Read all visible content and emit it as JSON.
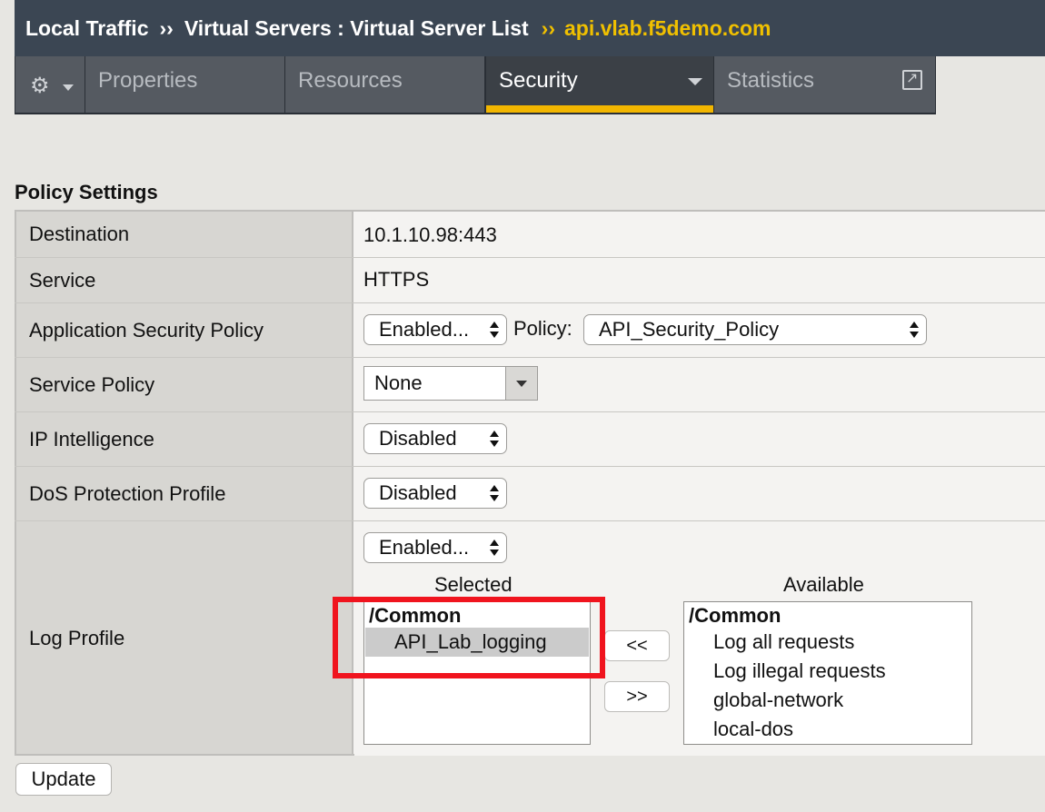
{
  "breadcrumb": {
    "part1": "Local Traffic",
    "sep": "››",
    "part2": "Virtual Servers : Virtual Server List",
    "current": "api.vlab.f5demo.com"
  },
  "tabs": {
    "menu_icon": "gear-icon",
    "items": [
      {
        "label": "Properties"
      },
      {
        "label": "Resources"
      },
      {
        "label": "Security"
      },
      {
        "label": "Statistics"
      }
    ],
    "active": "Security",
    "accent_color": "#f2b600"
  },
  "section_title": "Policy Settings",
  "rows": {
    "destination": {
      "label": "Destination",
      "value": "10.1.10.98:443"
    },
    "service": {
      "label": "Service",
      "value": "HTTPS"
    },
    "app_security": {
      "label": "Application Security Policy",
      "select": "Enabled...",
      "policy_label": "Policy:",
      "policy_value": "API_Security_Policy"
    },
    "service_policy": {
      "label": "Service Policy",
      "value": "None"
    },
    "ip_intel": {
      "label": "IP Intelligence",
      "select": "Disabled"
    },
    "dos": {
      "label": "DoS Protection Profile",
      "select": "Disabled"
    },
    "log_profile": {
      "label": "Log Profile",
      "select": "Enabled...",
      "selected_heading": "Selected",
      "available_heading": "Available",
      "selected_group": "/Common",
      "selected_items": [
        "API_Lab_logging"
      ],
      "available_group": "/Common",
      "available_items": [
        "Log all requests",
        "Log illegal requests",
        "global-network",
        "local-dos"
      ],
      "move_left": "<<",
      "move_right": ">>",
      "highlight_color": "#f0141e"
    }
  },
  "update_button": "Update"
}
